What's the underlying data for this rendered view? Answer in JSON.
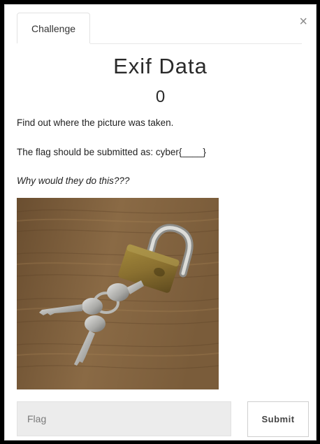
{
  "modal": {
    "tab_label": "Challenge",
    "close_label": "×",
    "title": "Exif Data",
    "points": "0",
    "description_line1": "Find out where the picture was taken.",
    "description_line2": "The flag should be submitted as: cyber{____}",
    "description_line3": "Why would they do this???",
    "image": {
      "subject": "brass padlock with keys on wooden surface"
    },
    "flag_input": {
      "placeholder": "Flag",
      "value": ""
    },
    "submit_label": "Submit"
  }
}
